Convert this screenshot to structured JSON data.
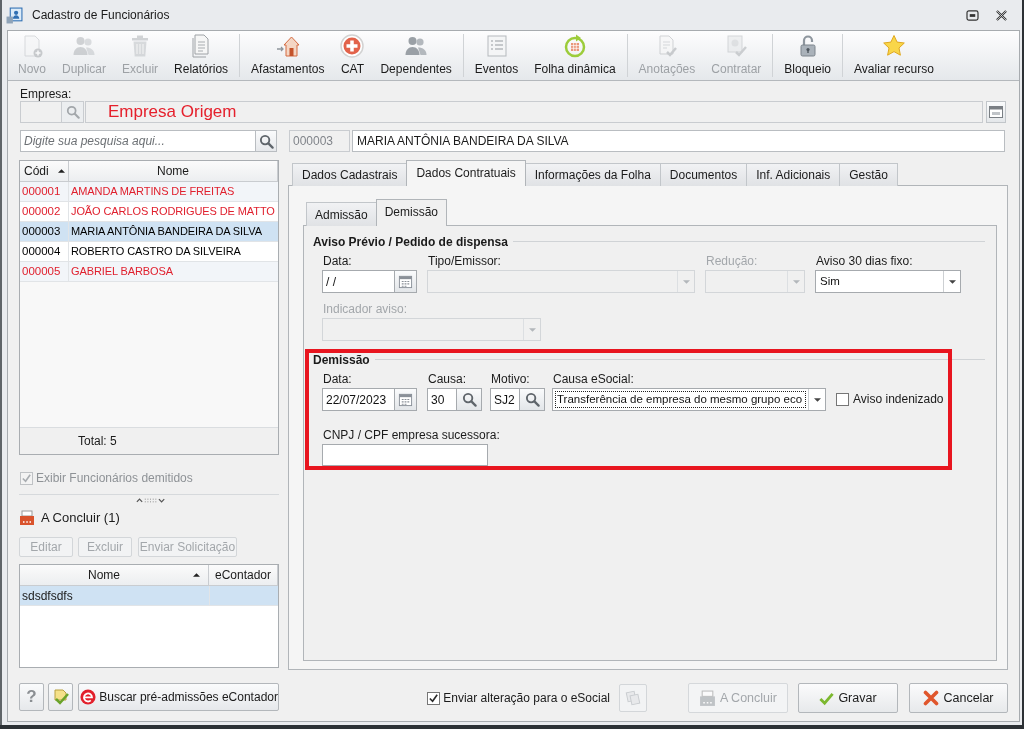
{
  "window": {
    "title": "Cadastro de Funcionários"
  },
  "toolbar": [
    {
      "buttons": [
        {
          "label": "Novo",
          "disabled": true
        },
        {
          "label": "Duplicar",
          "disabled": true
        },
        {
          "label": "Excluir",
          "disabled": true
        },
        {
          "label": "Relatórios",
          "disabled": false
        }
      ]
    },
    {
      "buttons": [
        {
          "label": "Afastamentos",
          "disabled": false
        },
        {
          "label": "CAT",
          "disabled": false
        },
        {
          "label": "Dependentes",
          "disabled": false
        }
      ]
    },
    {
      "buttons": [
        {
          "label": "Eventos",
          "disabled": false
        },
        {
          "label": "Folha dinâmica",
          "disabled": false
        }
      ]
    },
    {
      "buttons": [
        {
          "label": "Anotações",
          "disabled": true
        },
        {
          "label": "Contratar",
          "disabled": true
        }
      ]
    },
    {
      "buttons": [
        {
          "label": "Bloqueio",
          "disabled": false
        }
      ]
    },
    {
      "buttons": [
        {
          "label": "Avaliar recurso",
          "disabled": false
        }
      ]
    }
  ],
  "empresa": {
    "label": "Empresa:",
    "name": "Empresa Origem"
  },
  "search": {
    "placeholder": "Digite sua pesquisa aqui..."
  },
  "employee_table": {
    "columns": [
      {
        "label": "Códi",
        "sorted": true
      },
      {
        "label": "Nome",
        "sorted": false
      }
    ],
    "rows": [
      {
        "code": "000001",
        "name": "AMANDA MARTINS DE FREITAS",
        "color": "#e0202e",
        "selected": false
      },
      {
        "code": "000002",
        "name": "JOÃO CARLOS RODRIGUES DE MATTO",
        "color": "#e0202e",
        "selected": false
      },
      {
        "code": "000003",
        "name": "MARIA ANTÔNIA BANDEIRA DA SILVA",
        "color": "#000000",
        "selected": true
      },
      {
        "code": "000004",
        "name": "ROBERTO CASTRO DA SILVEIRA",
        "color": "#000000",
        "selected": false
      },
      {
        "code": "000005",
        "name": "GABRIEL BARBOSA",
        "color": "#e0202e",
        "selected": false
      }
    ],
    "total": "Total: 5"
  },
  "show_dismissed": {
    "label": "Exibir Funcionários demitidos",
    "checked": true,
    "disabled": true
  },
  "pending": {
    "title": "A Concluir (1)",
    "buttons": [
      {
        "label": "Editar",
        "disabled": true
      },
      {
        "label": "Excluir",
        "disabled": true
      },
      {
        "label": "Enviar Solicitação",
        "disabled": true
      }
    ],
    "table": {
      "columns": [
        {
          "label": "Nome",
          "sorted": true
        },
        {
          "label": "eContador",
          "sorted": false
        }
      ],
      "rows": [
        {
          "name": "sdsdfsdfs",
          "selected": true
        }
      ]
    }
  },
  "left_footer": {
    "help": "?",
    "fetch_button": "Buscar pré-admissões eContador"
  },
  "employee": {
    "code": "000003",
    "name": "MARIA ANTÔNIA BANDEIRA DA SILVA"
  },
  "tabs": [
    {
      "label": "Dados Cadastrais",
      "selected": false
    },
    {
      "label": "Dados Contratuais",
      "selected": true
    },
    {
      "label": "Informações da Folha",
      "selected": false
    },
    {
      "label": "Documentos",
      "selected": false
    },
    {
      "label": "Inf. Adicionais",
      "selected": false
    },
    {
      "label": "Gestão",
      "selected": false
    }
  ],
  "subtabs": [
    {
      "label": "Admissão",
      "selected": false
    },
    {
      "label": "Demissão",
      "selected": true
    }
  ],
  "groups": [
    {
      "title": "Aviso Prévio / Pedido de dispensa",
      "highlighted": false,
      "rows": [
        [
          {
            "kind": "date",
            "label": "Data:",
            "value": "/ /",
            "disabled": false,
            "label_disabled": false,
            "focused": false
          },
          {
            "kind": "combo",
            "label": "Tipo/Emissor:",
            "disabled": true,
            "label_disabled": false,
            "focused": false
          },
          {
            "kind": "combo",
            "label": "Redução:",
            "disabled": true,
            "label_disabled": true,
            "focused": false
          },
          {
            "kind": "combo",
            "label": "Aviso 30 dias fixo:",
            "value": "Sim",
            "disabled": false,
            "label_disabled": false,
            "focused": false
          }
        ],
        [
          {
            "kind": "combo",
            "label": "Indicador aviso:",
            "disabled": true,
            "label_disabled": true,
            "focused": false
          }
        ]
      ]
    },
    {
      "title": "Demissão",
      "highlighted": true,
      "rows": [
        [
          {
            "kind": "date",
            "label": "Data:",
            "value": "22/07/2023",
            "disabled": false,
            "label_disabled": false,
            "focused": false
          },
          {
            "kind": "lookup",
            "label": "Causa:",
            "value": "30",
            "disabled": false,
            "label_disabled": false,
            "focused": false
          },
          {
            "kind": "lookup",
            "label": "Motivo:",
            "value": "SJ2",
            "disabled": false,
            "label_disabled": false,
            "focused": false
          },
          {
            "kind": "combo",
            "label": "Causa eSocial:",
            "value": "Transferência de empresa do mesmo grupo eco",
            "disabled": false,
            "label_disabled": false,
            "focused": true
          },
          {
            "kind": "checkbox",
            "label": "Aviso indenizado",
            "checked": false,
            "disabled": false,
            "label_disabled": false,
            "focused": false
          }
        ],
        [
          {
            "kind": "text",
            "label": "CNPJ / CPF empresa sucessora:",
            "disabled": false,
            "label_disabled": false,
            "focused": false
          }
        ]
      ]
    }
  ],
  "esocial": {
    "label": "Enviar alteração para o eSocial",
    "checked": true
  },
  "copy_button": {
    "disabled": true
  },
  "actions": [
    {
      "label": "A Concluir",
      "disabled": true
    },
    {
      "label": "Gravar",
      "disabled": false
    },
    {
      "label": "Cancelar",
      "disabled": false
    }
  ]
}
